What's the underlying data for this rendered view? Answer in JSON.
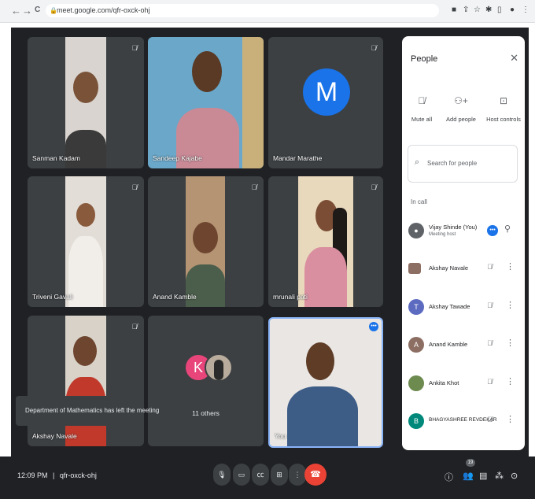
{
  "browser": {
    "back": "←",
    "forward": "→",
    "reload": "C",
    "url": "meet.google.com/qfr-oxck-ohj",
    "icons": [
      "camera-icon",
      "share-icon",
      "star-icon",
      "extension-icon",
      "tab-icon",
      "profile-icon",
      "menu-icon"
    ]
  },
  "tiles": [
    {
      "name": "Sanman Kadam",
      "muted": true
    },
    {
      "name": "Sandeep Kajabe",
      "muted": false
    },
    {
      "name": "Mandar Marathe",
      "muted": true,
      "avatar_letter": "M"
    },
    {
      "name": "Triveni Gavali",
      "muted": true
    },
    {
      "name": "Anand Kamble",
      "muted": true
    },
    {
      "name": "mrunali pati",
      "muted": true
    },
    {
      "name": "Akshay Navale",
      "muted": true
    },
    {
      "name": "11 others",
      "avatar_letter": "K"
    },
    {
      "name": "You"
    }
  ],
  "toast": "Department of Mathematics has left the meeting",
  "people_panel": {
    "title": "People",
    "actions": [
      {
        "label": "Mute all",
        "icon": "mic-off-icon"
      },
      {
        "label": "Add people",
        "icon": "add-person-icon"
      },
      {
        "label": "Host controls",
        "icon": "host-controls-icon"
      }
    ],
    "search_placeholder": "Search for people",
    "section": "In call",
    "participants": [
      {
        "name": "Vijay Shinde (You)",
        "role": "Meeting host",
        "color": "#5f6368"
      },
      {
        "name": "Akshay Navale",
        "color": "#8d6e63"
      },
      {
        "name": "Akshay Tawade",
        "letter": "T",
        "color": "#5c6bc0"
      },
      {
        "name": "Anand Kamble",
        "letter": "A",
        "color": "#8d6e63"
      },
      {
        "name": "Ankita Khot",
        "color": "#6d8a4f"
      },
      {
        "name": "BHAGYASHREE REVDEKAR",
        "letter": "B",
        "color": "#00897b"
      }
    ]
  },
  "bottom_bar": {
    "time": "12:09 PM",
    "separator": "|",
    "meeting_code": "qfr-oxck-ohj",
    "people_count": "19",
    "end_call_icon": "phone-hangup-icon"
  },
  "colors": {
    "meet_bg": "#202124",
    "tile_bg": "#3c4043",
    "accent": "#1a73e8",
    "end_call": "#ea4335"
  }
}
